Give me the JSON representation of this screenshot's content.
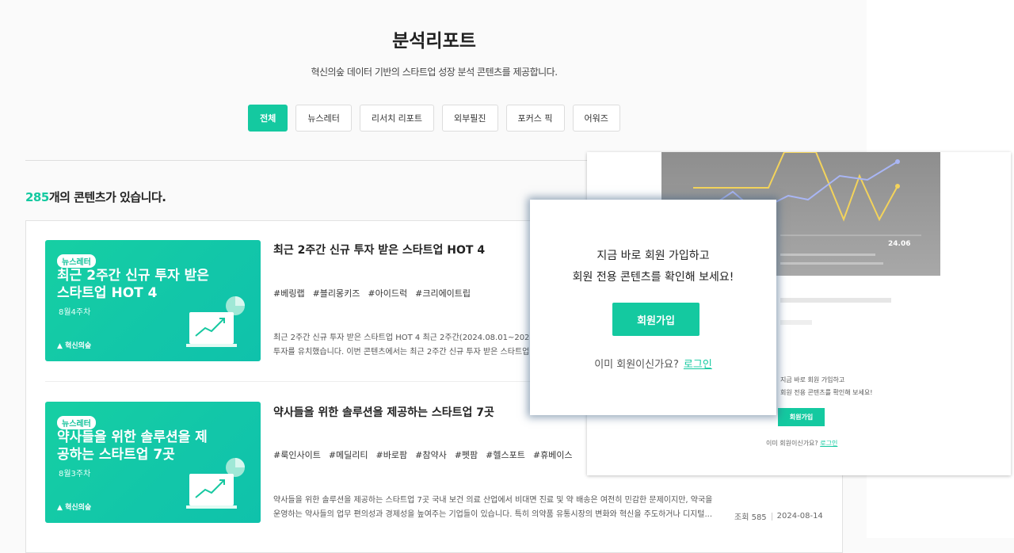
{
  "header": {
    "title": "분석리포트",
    "subtitle": "혁신의숲 데이터 기반의 스타트업 성장 분석 콘텐츠를 제공합니다."
  },
  "tabs": [
    {
      "label": "전체",
      "active": true
    },
    {
      "label": "뉴스레터",
      "active": false
    },
    {
      "label": "리서치 리포트",
      "active": false
    },
    {
      "label": "외부필진",
      "active": false
    },
    {
      "label": "포커스 픽",
      "active": false
    },
    {
      "label": "어워즈",
      "active": false
    }
  ],
  "count": {
    "number": "285",
    "suffix": "개의 콘텐츠가 있습니다."
  },
  "items": [
    {
      "card": {
        "badge": "뉴스레터",
        "title": "최근 2주간 신규 투자 받은 스타트업 HOT 4",
        "week": "8월4주차",
        "logo": "혁신의숲"
      },
      "title": "최근 2주간 신규 투자 받은 스타트업 HOT 4",
      "tags": [
        "#베링랩",
        "#블리몽키즈",
        "#아이드럭",
        "#크리에이트립"
      ],
      "desc1": "최근 2주간 신규 투자 받은 스타트업 HOT 4 최근 2주간(2024.08.01~2024.0",
      "desc2": "투자를 유치했습니다. 이번 콘텐츠에서는 최근 2주간 신규 투자 받은 스타트업 중"
    },
    {
      "card": {
        "badge": "뉴스레터",
        "title": "약사들을 위한 솔루션을 제공하는 스타트업 7곳",
        "week": "8월3주차",
        "logo": "혁신의숲"
      },
      "title": "약사들을 위한 솔루션을 제공하는 스타트업 7곳",
      "tags": [
        "#룩인사이트",
        "#메딜리티",
        "#바로팜",
        "#참약사",
        "#펫팜",
        "#헬스포트",
        "#휴베이스"
      ],
      "desc1": "약사들을 위한 솔루션을 제공하는 스타트업 7곳 국내 보건 의료 산업에서 비대면 진료 및 약 배송은 여전히 민감한 문제이지만, 약국을",
      "desc2": "운영하는 약사들의 업무 편의성과 경제성을 높여주는 기업들이 있습니다. 특히 의약품 유통시장의 변화와 혁신을 주도하거나 디지털...",
      "views": "조회 585",
      "date": "2024-08-14"
    }
  ],
  "background_capture": {
    "chart_label": "24.06",
    "note1": "지금 바로 회원 가입하고",
    "note2": "회원 전용 콘텐츠를 확인해 보세요!",
    "join": "회원가입",
    "login_q": "이미 회원이신가요?",
    "login": "로그인"
  },
  "popup": {
    "line1": "지금 바로 회원 가입하고",
    "line2": "회원 전용 콘텐츠를 확인해 보세요!",
    "join_label": "회원가입",
    "login_question": "이미 회원이신가요?",
    "login_label": "로그인"
  },
  "colors": {
    "accent": "#14c9a0"
  }
}
